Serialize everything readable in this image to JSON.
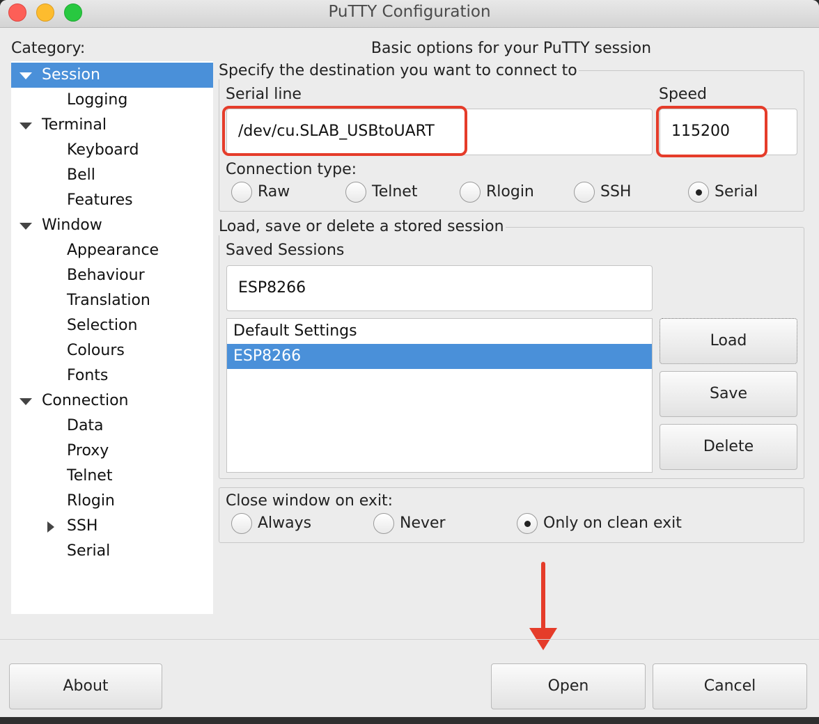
{
  "window": {
    "title": "PuTTY Configuration"
  },
  "category": {
    "label": "Category:",
    "items": [
      {
        "label": "Session",
        "level": 0,
        "expander": "expanded",
        "selected": true
      },
      {
        "label": "Logging",
        "level": 1
      },
      {
        "label": "Terminal",
        "level": 0,
        "expander": "expanded"
      },
      {
        "label": "Keyboard",
        "level": 1
      },
      {
        "label": "Bell",
        "level": 1
      },
      {
        "label": "Features",
        "level": 1
      },
      {
        "label": "Window",
        "level": 0,
        "expander": "expanded"
      },
      {
        "label": "Appearance",
        "level": 1
      },
      {
        "label": "Behaviour",
        "level": 1
      },
      {
        "label": "Translation",
        "level": 1
      },
      {
        "label": "Selection",
        "level": 1
      },
      {
        "label": "Colours",
        "level": 1
      },
      {
        "label": "Fonts",
        "level": 1
      },
      {
        "label": "Connection",
        "level": 0,
        "expander": "expanded"
      },
      {
        "label": "Data",
        "level": 1
      },
      {
        "label": "Proxy",
        "level": 1
      },
      {
        "label": "Telnet",
        "level": 1
      },
      {
        "label": "Rlogin",
        "level": 1
      },
      {
        "label": "SSH",
        "level": 1,
        "expander": "collapsed"
      },
      {
        "label": "Serial",
        "level": 1
      }
    ]
  },
  "session": {
    "heading": "Basic options for your PuTTY session",
    "destination": {
      "group_title": "Specify the destination you want to connect to",
      "serial_line_label": "Serial line",
      "serial_line_value": "/dev/cu.SLAB_USBtoUART",
      "speed_label": "Speed",
      "speed_value": "115200",
      "connection_type_label": "Connection type:",
      "connection_types": [
        {
          "label": "Raw",
          "selected": false
        },
        {
          "label": "Telnet",
          "selected": false
        },
        {
          "label": "Rlogin",
          "selected": false
        },
        {
          "label": "SSH",
          "selected": false
        },
        {
          "label": "Serial",
          "selected": true
        }
      ]
    },
    "stored": {
      "group_title": "Load, save or delete a stored session",
      "saved_sessions_label": "Saved Sessions",
      "saved_sessions_value": "ESP8266",
      "sessions": [
        {
          "label": "Default Settings",
          "selected": false
        },
        {
          "label": "ESP8266",
          "selected": true
        }
      ],
      "load_label": "Load",
      "save_label": "Save",
      "delete_label": "Delete"
    },
    "close_on_exit": {
      "label": "Close window on exit:",
      "options": [
        {
          "label": "Always",
          "selected": false
        },
        {
          "label": "Never",
          "selected": false
        },
        {
          "label": "Only on clean exit",
          "selected": true
        }
      ]
    }
  },
  "footer": {
    "about_label": "About",
    "open_label": "Open",
    "cancel_label": "Cancel"
  },
  "annotation_color": "#e53c2a"
}
